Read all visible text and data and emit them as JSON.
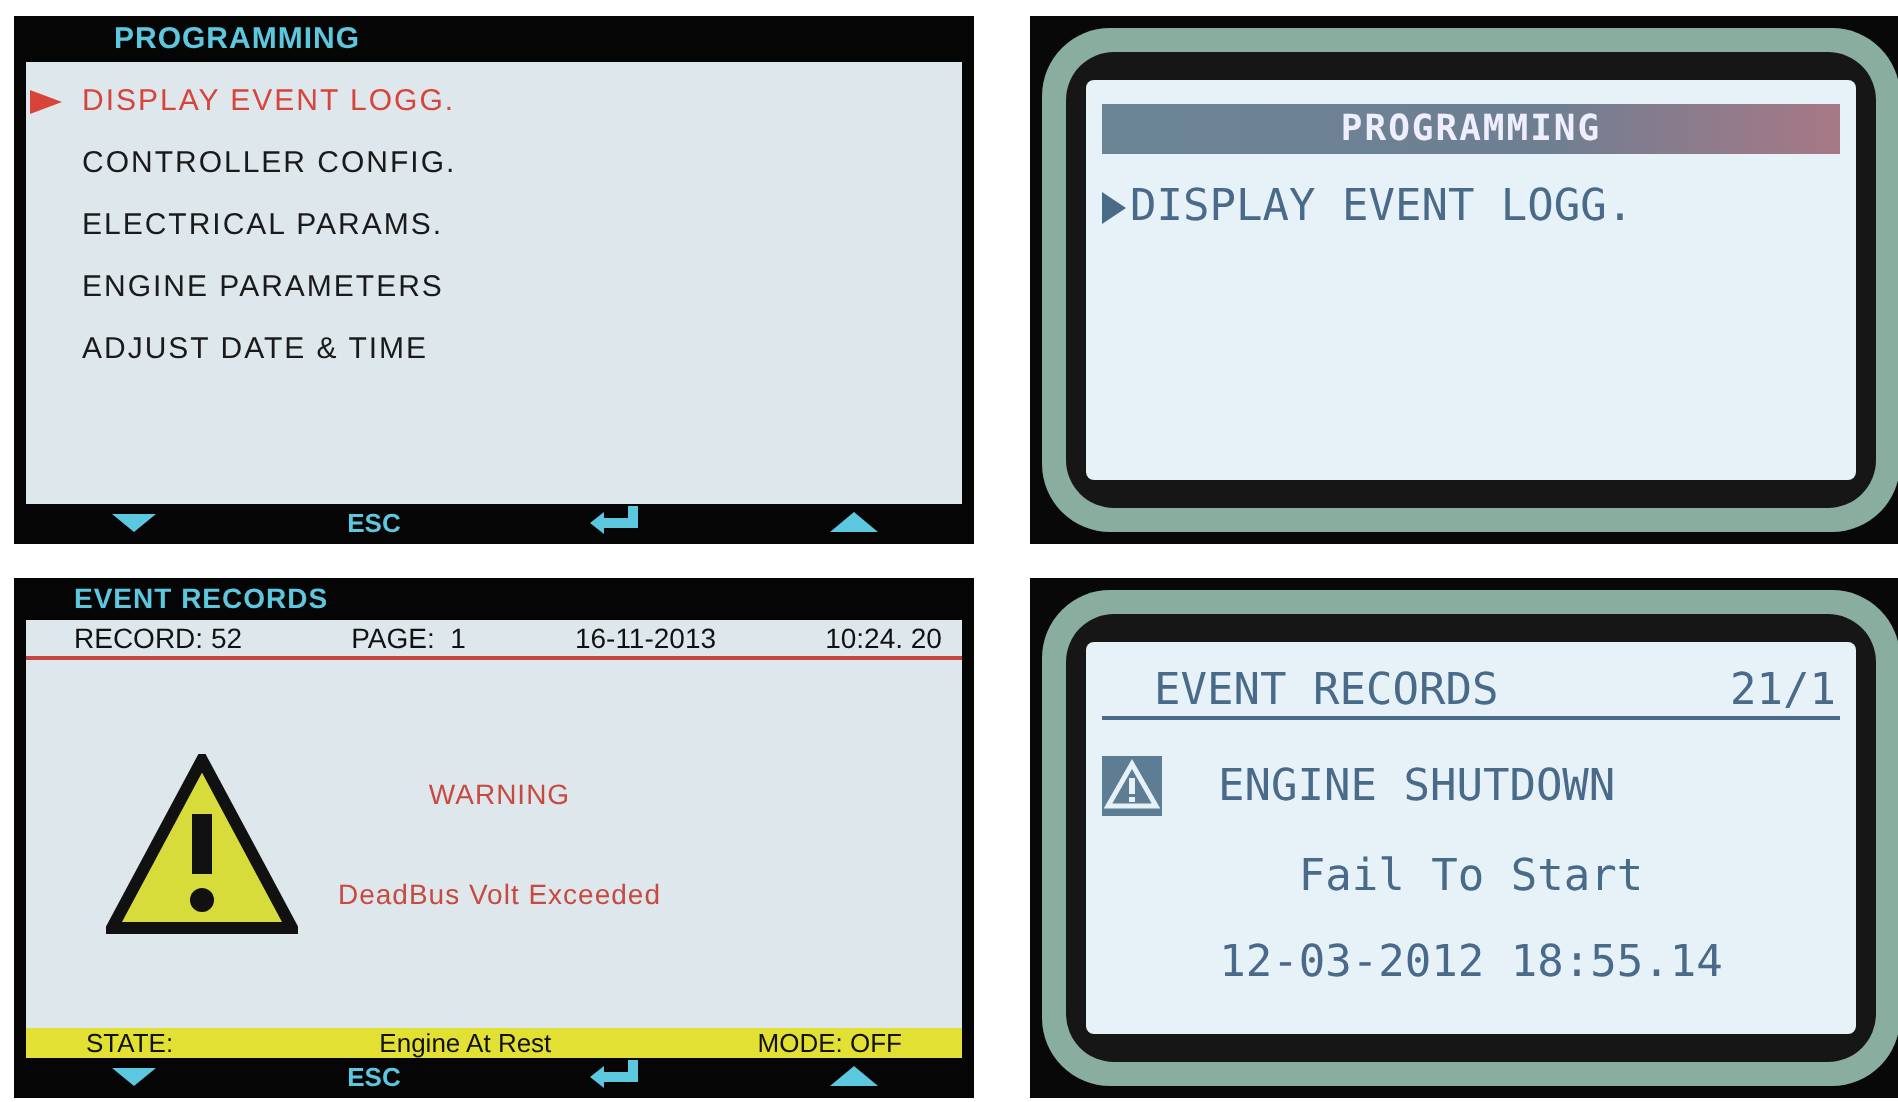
{
  "panels": [
    {
      "kind": "color_menu",
      "title": "PROGRAMMING",
      "items": [
        {
          "label": "DISPLAY EVENT LOGG.",
          "selected": true
        },
        {
          "label": "CONTROLLER CONFIG.",
          "selected": false
        },
        {
          "label": "ELECTRICAL PARAMS.",
          "selected": false
        },
        {
          "label": "ENGINE PARAMETERS",
          "selected": false
        },
        {
          "label": "ADJUST DATE & TIME",
          "selected": false
        }
      ],
      "esc_label": "ESC"
    },
    {
      "kind": "lcd_menu",
      "title": "PROGRAMMING",
      "items": [
        {
          "label": "DISPLAY EVENT LOGG.",
          "selected": true
        }
      ]
    },
    {
      "kind": "color_event",
      "title": "EVENT RECORDS",
      "record_bar": [
        "RECORD: 52",
        "PAGE:  1",
        "16-11-2013",
        "10:24. 20"
      ],
      "heading": "WARNING",
      "message": "DeadBus Volt Exceeded",
      "state_label": "STATE:",
      "state": "Engine At Rest",
      "mode": "MODE: OFF",
      "esc_label": "ESC"
    },
    {
      "kind": "lcd_event",
      "title": "EVENT RECORDS",
      "counter": "21/1",
      "heading": "ENGINE SHUTDOWN",
      "message": "Fail To Start",
      "timestamp": "12-03-2012 18:55.14"
    }
  ]
}
